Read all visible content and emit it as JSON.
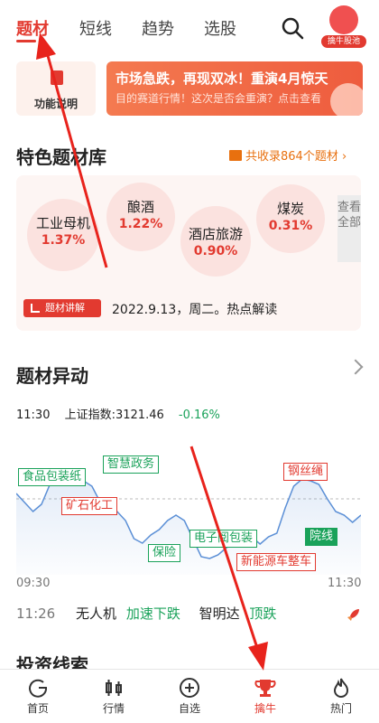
{
  "tabs": [
    {
      "label": "题材",
      "active": true
    },
    {
      "label": "短线",
      "active": false
    },
    {
      "label": "趋势",
      "active": false
    },
    {
      "label": "选股",
      "active": false
    }
  ],
  "avatar_label": "擒牛股池",
  "function_card_label": "功能说明",
  "banner": {
    "title": "市场急跌，再现双冰！重演4月惊天",
    "subtitle": "目的赛道行情！这次是否会重演？点击查看"
  },
  "feature_section": {
    "title": "特色题材库",
    "collection_link": "共收录864个题材 ›"
  },
  "themes": [
    {
      "name": "工业母机",
      "pct": "1.37%"
    },
    {
      "name": "酿酒",
      "pct": "1.22%"
    },
    {
      "name": "酒店旅游",
      "pct": "0.90%"
    },
    {
      "name": "煤炭",
      "pct": "0.31%"
    }
  ],
  "view_all": "查看全部",
  "explain_tag": "题材讲解",
  "explain_text": "2022.9.13，周二。热点解读",
  "anomaly_section": {
    "title": "题材异动"
  },
  "chart_data": {
    "type": "line",
    "header": {
      "time": "11:30",
      "index": "上证指数:3121.46",
      "change": "-0.16%"
    },
    "x_start": "09:30",
    "x_end": "11:30",
    "line_color": "#5b8fd6",
    "annotations": [
      {
        "label": "食品包装纸",
        "color": "green"
      },
      {
        "label": "矿石化工",
        "color": "red"
      },
      {
        "label": "智慧政务",
        "color": "green"
      },
      {
        "label": "保险",
        "color": "green"
      },
      {
        "label": "电子阅包装",
        "color": "green"
      },
      {
        "label": "钢丝绳",
        "color": "red"
      },
      {
        "label": "新能源车整车",
        "color": "red"
      },
      {
        "label": "院线",
        "color": "solid-green"
      }
    ]
  },
  "news": {
    "time": "11:26",
    "items": [
      {
        "name": "无人机",
        "status": "加速下跌"
      },
      {
        "name": "智明达",
        "status": "顶跌"
      }
    ]
  },
  "clue_section": {
    "title": "投资线索"
  },
  "bottom_nav": [
    {
      "label": "首页",
      "icon": "home-icon",
      "active": false
    },
    {
      "label": "行情",
      "icon": "candlestick-icon",
      "active": false
    },
    {
      "label": "自选",
      "icon": "plus-circle-icon",
      "active": false
    },
    {
      "label": "擒牛",
      "icon": "trophy-icon",
      "active": true
    },
    {
      "label": "热门",
      "icon": "flame-icon",
      "active": false
    }
  ]
}
